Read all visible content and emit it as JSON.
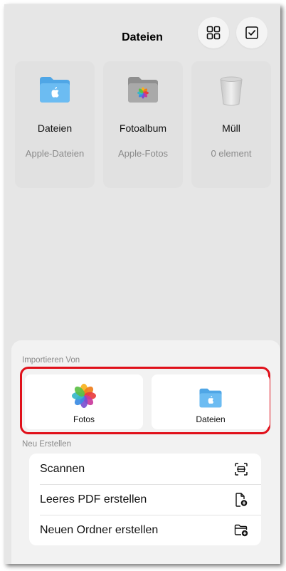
{
  "header": {
    "title": "Dateien"
  },
  "cards": [
    {
      "title": "Dateien",
      "subtitle": "Apple-Dateien",
      "icon": "blue-folder-icon"
    },
    {
      "title": "Fotoalbum",
      "subtitle": "Apple-Fotos",
      "icon": "photo-album-folder-icon"
    },
    {
      "title": "Müll",
      "subtitle": "0 element",
      "icon": "trash-can-icon"
    }
  ],
  "sheet": {
    "import_label": "Importieren Von",
    "import_options": [
      {
        "label": "Fotos",
        "icon": "photos-app-icon"
      },
      {
        "label": "Dateien",
        "icon": "blue-folder-icon"
      }
    ],
    "create_label": "Neu Erstellen",
    "create_items": [
      {
        "label": "Scannen",
        "icon": "scan-icon"
      },
      {
        "label": "Leeres PDF erstellen",
        "icon": "new-document-icon"
      },
      {
        "label": "Neuen Ordner erstellen",
        "icon": "new-folder-icon"
      }
    ]
  },
  "colors": {
    "highlight": "#e0101a",
    "folder_blue": "#5fb3ee",
    "background": "#e6e6e6"
  }
}
